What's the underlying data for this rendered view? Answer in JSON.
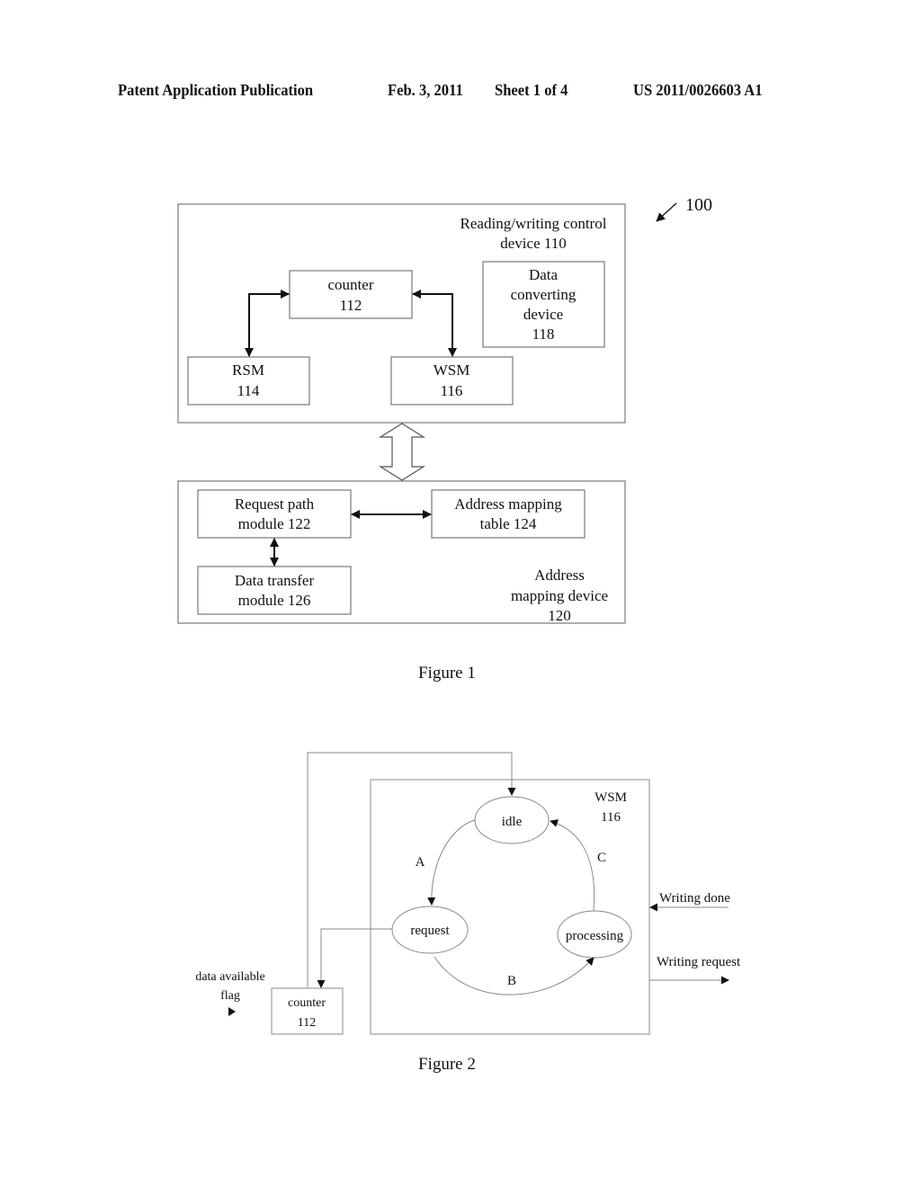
{
  "header": {
    "publication": "Patent Application Publication",
    "date": "Feb. 3, 2011",
    "sheet": "Sheet 1 of 4",
    "number": "US 2011/0026603 A1"
  },
  "figure1": {
    "ref": "100",
    "rw_device": {
      "line1": "Reading/writing control",
      "line2": "device 110"
    },
    "counter": {
      "line1": "counter",
      "line2": "112"
    },
    "data_converting": {
      "line1": "Data",
      "line2": "converting",
      "line3": "device",
      "line4": "118"
    },
    "rsm": {
      "line1": "RSM",
      "line2": "114"
    },
    "wsm": {
      "line1": "WSM",
      "line2": "116"
    },
    "request_path": {
      "line1": "Request path",
      "line2": "module 122"
    },
    "address_table": {
      "line1": "Address mapping",
      "line2": "table 124"
    },
    "data_transfer": {
      "line1": "Data transfer",
      "line2": "module 126"
    },
    "address_device": {
      "line1": "Address",
      "line2": "mapping device",
      "line3": "120"
    },
    "caption": "Figure 1"
  },
  "figure2": {
    "wsm": {
      "line1": "WSM",
      "line2": "116"
    },
    "states": {
      "idle": "idle",
      "request": "request",
      "processing": "processing"
    },
    "transitions": {
      "a": "A",
      "b": "B",
      "c": "C"
    },
    "writing_done": "Writing done",
    "writing_request": "Writing request",
    "data_flag": {
      "line1": "data available",
      "line2": "flag"
    },
    "counter": {
      "line1": "counter",
      "line2": "112"
    },
    "caption": "Figure 2"
  }
}
